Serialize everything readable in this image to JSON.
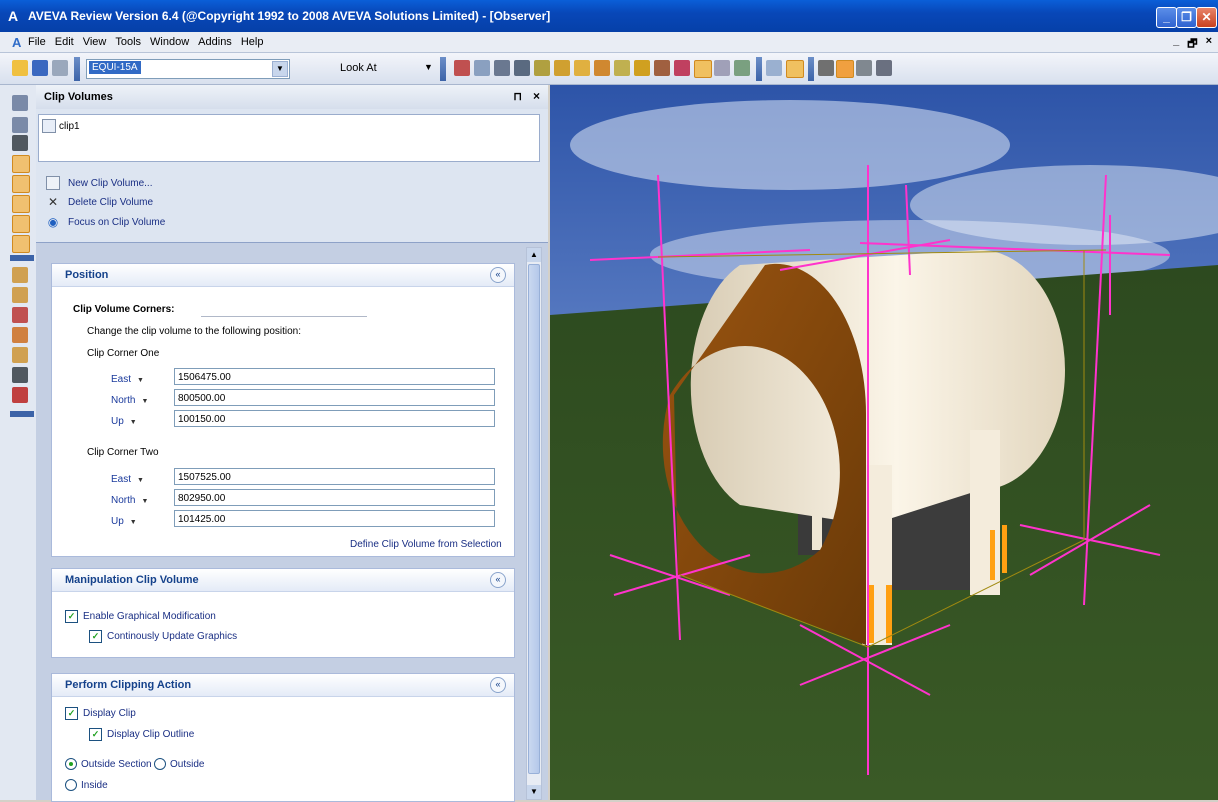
{
  "window": {
    "title": "AVEVA Review Version 6.4 (@Copyright 1992 to 2008 AVEVA Solutions Limited) - [Observer]",
    "logo": "A",
    "minimize": "_",
    "restore": "❐",
    "close": "✕"
  },
  "menu": {
    "items": [
      "File",
      "Edit",
      "View",
      "Tools",
      "Window",
      "Addins",
      "Help"
    ],
    "mdi_min": "_",
    "mdi_restore": "🗗",
    "mdi_close": "×"
  },
  "toolbar": {
    "element_combo_value": "EQUI-15A",
    "look_at_label": "Look At",
    "dropdown_glyph": "▼"
  },
  "panel": {
    "title": "Clip Volumes",
    "pin": "⊓",
    "close": "×",
    "clip_list": [
      "clip1"
    ],
    "actions": {
      "new": "New Clip Volume...",
      "delete": "Delete Clip Volume",
      "focus": "Focus on Clip Volume"
    }
  },
  "position": {
    "header": "Position",
    "chevron": "«",
    "corners_label": "Clip Volume Corners:",
    "instruction": "Change the clip volume to the following position:",
    "corner_one_label": "Clip Corner One",
    "corner_two_label": "Clip Corner Two",
    "dir_east": "East",
    "dir_north": "North",
    "dir_up": "Up",
    "dir_dropdown": "▼",
    "corner_one": {
      "east": "1506475.00",
      "north": "800500.00",
      "up": "100150.00"
    },
    "corner_two": {
      "east": "1507525.00",
      "north": "802950.00",
      "up": "101425.00"
    },
    "define_link": "Define Clip Volume from Selection"
  },
  "manipulation": {
    "header": "Manipulation Clip Volume",
    "enable_graphical": "Enable Graphical Modification",
    "continuous_update": "Continously Update Graphics",
    "enable_graphical_checked": true,
    "continuous_update_checked": true
  },
  "clipping": {
    "header": "Perform Clipping Action",
    "display_clip": "Display Clip",
    "display_outline": "Display Clip Outline",
    "outside_section": "Outside Section",
    "outside": "Outside",
    "inside": "Inside",
    "display_clip_checked": true,
    "display_outline_checked": true,
    "selected_mode": "Outside Section"
  },
  "check_glyph": "✓",
  "colors": {
    "title_bar": "#0847b8",
    "panel_bg": "#c4cfe3",
    "section_header_text": "#15428b",
    "link_text": "#1a2f84",
    "clip_outline": "#ff33cc",
    "tank_shell": "#f3ead8",
    "clip_face": "#8a4a0c",
    "sky": "#4a6fb8",
    "ground": "#2a4a1c"
  }
}
